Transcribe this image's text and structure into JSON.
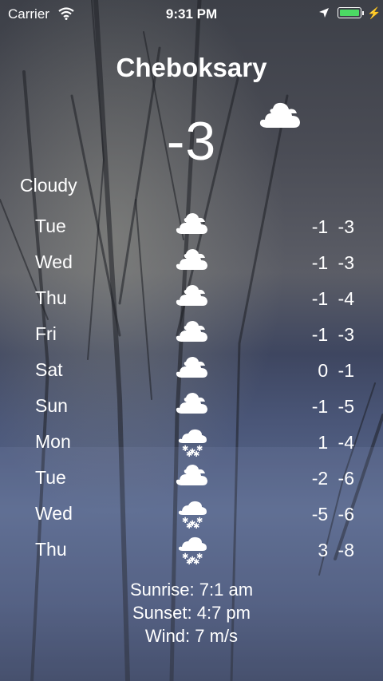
{
  "status_bar": {
    "carrier": "Carrier",
    "time": "9:31 PM",
    "battery_color": "#4cd964"
  },
  "weather": {
    "city": "Cheboksary",
    "current_temp": "-3",
    "condition": "Cloudy",
    "current_icon": "cloud-icon"
  },
  "forecast": [
    {
      "day": "Tue",
      "icon": "cloud-icon",
      "temps": "-1  -3"
    },
    {
      "day": "Wed",
      "icon": "cloud-icon",
      "temps": "-1  -3"
    },
    {
      "day": "Thu",
      "icon": "cloud-icon",
      "temps": "-1  -4"
    },
    {
      "day": "Fri",
      "icon": "cloud-icon",
      "temps": "-1  -3"
    },
    {
      "day": "Sat",
      "icon": "cloud-icon",
      "temps": "0  -1"
    },
    {
      "day": "Sun",
      "icon": "cloud-icon",
      "temps": "-1  -5"
    },
    {
      "day": "Mon",
      "icon": "snow-icon",
      "temps": "1  -4"
    },
    {
      "day": "Tue",
      "icon": "cloud-icon",
      "temps": "-2  -6"
    },
    {
      "day": "Wed",
      "icon": "snow-icon",
      "temps": "-5  -6"
    },
    {
      "day": "Thu",
      "icon": "snow-icon",
      "temps": "3  -8"
    }
  ],
  "details": {
    "sunrise": "Sunrise:  7:1 am",
    "sunset": "Sunset:  4:7 pm",
    "wind": "Wind:  7 m/s"
  }
}
